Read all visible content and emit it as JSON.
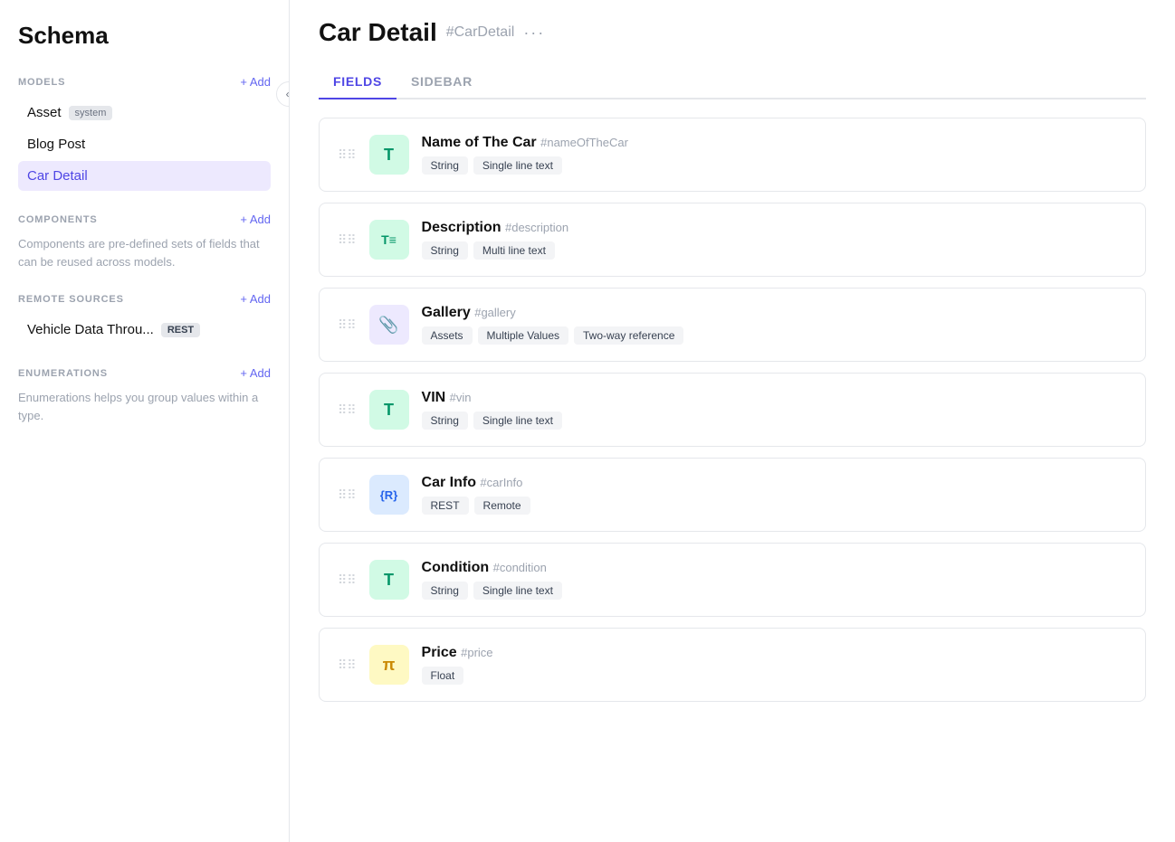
{
  "sidebar": {
    "title": "Schema",
    "models_section": {
      "label": "MODELS",
      "add_label": "+ Add",
      "items": [
        {
          "name": "Asset",
          "badge": "system",
          "active": false
        },
        {
          "name": "Blog Post",
          "badge": null,
          "active": false
        },
        {
          "name": "Car Detail",
          "badge": null,
          "active": true
        }
      ]
    },
    "components_section": {
      "label": "COMPONENTS",
      "add_label": "+ Add",
      "description": "Components are pre-defined sets of fields that can be reused across models."
    },
    "remote_sources_section": {
      "label": "REMOTE SOURCES",
      "add_label": "+ Add",
      "items": [
        {
          "name": "Vehicle Data Throu...",
          "badge": "REST"
        }
      ]
    },
    "enumerations_section": {
      "label": "ENUMERATIONS",
      "add_label": "+ Add",
      "description": "Enumerations helps you group values within a type."
    }
  },
  "main": {
    "page_title": "Car Detail",
    "page_id": "#CarDetail",
    "more_icon": "···",
    "tabs": [
      {
        "label": "FIELDS",
        "active": true
      },
      {
        "label": "SIDEBAR",
        "active": false
      }
    ],
    "fields": [
      {
        "name": "Name of The Car",
        "id": "#nameOfTheCar",
        "icon_type": "T",
        "icon_class": "icon-green",
        "tags": [
          "String",
          "Single line text"
        ]
      },
      {
        "name": "Description",
        "id": "#description",
        "icon_type": "T≡",
        "icon_class": "icon-green",
        "tags": [
          "String",
          "Multi line text"
        ]
      },
      {
        "name": "Gallery",
        "id": "#gallery",
        "icon_type": "📎",
        "icon_class": "icon-purple",
        "tags": [
          "Assets",
          "Multiple Values",
          "Two-way reference"
        ]
      },
      {
        "name": "VIN",
        "id": "#vin",
        "icon_type": "T",
        "icon_class": "icon-green",
        "tags": [
          "String",
          "Single line text"
        ]
      },
      {
        "name": "Car Info",
        "id": "#carInfo",
        "icon_type": "{R}",
        "icon_class": "icon-blue",
        "tags": [
          "REST",
          "Remote"
        ]
      },
      {
        "name": "Condition",
        "id": "#condition",
        "icon_type": "T",
        "icon_class": "icon-green",
        "tags": [
          "String",
          "Single line text"
        ]
      },
      {
        "name": "Price",
        "id": "#price",
        "icon_type": "π",
        "icon_class": "icon-yellow",
        "tags": [
          "Float"
        ]
      }
    ]
  },
  "icons": {
    "drag": "⠿",
    "collapse": "«"
  }
}
